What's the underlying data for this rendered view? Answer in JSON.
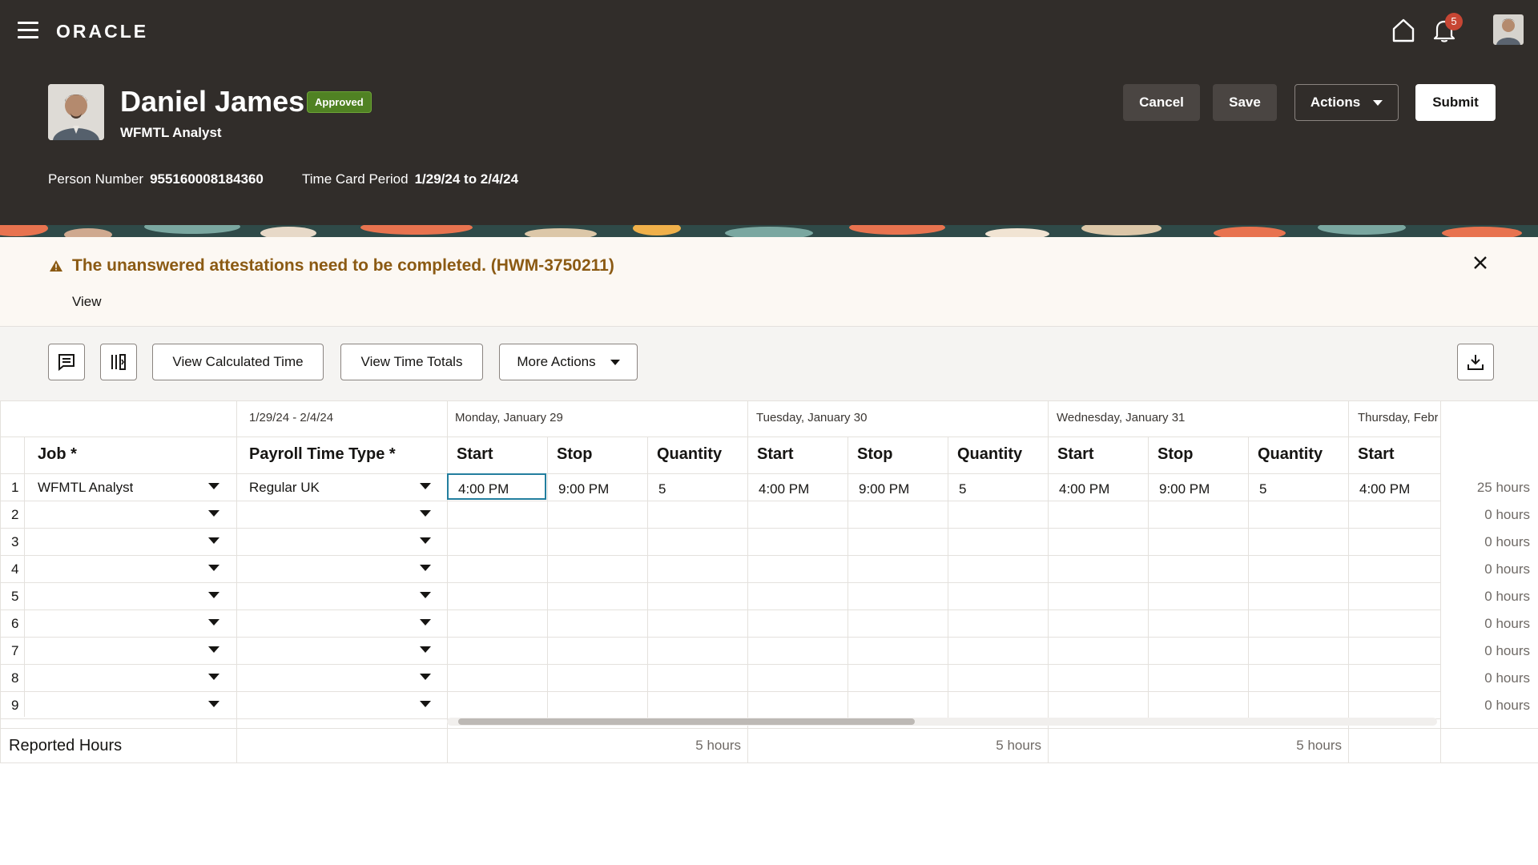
{
  "header": {
    "brand": "ORACLE",
    "notification_count": "5",
    "person_name": "Daniel James",
    "status": "Approved",
    "job_title": "WFMTL Analyst",
    "buttons": {
      "cancel": "Cancel",
      "save": "Save",
      "actions": "Actions",
      "submit": "Submit"
    },
    "person_number_label": "Person Number",
    "person_number": "955160008184360",
    "period_label": "Time Card Period",
    "period": "1/29/24 to 2/4/24"
  },
  "warning": {
    "message": "The unanswered attestations need to be completed. (HWM-3750211)",
    "link": "View"
  },
  "toolbar": {
    "view_calculated": "View Calculated Time",
    "view_totals": "View Time Totals",
    "more_actions": "More Actions"
  },
  "grid": {
    "range": "1/29/24 - 2/4/24",
    "days": [
      "Monday, January 29",
      "Tuesday, January 30",
      "Wednesday, January 31",
      "Thursday, Febr"
    ],
    "columns": {
      "job": "Job *",
      "payroll": "Payroll Time Type *",
      "start": "Start",
      "stop": "Stop",
      "quantity": "Quantity"
    },
    "rows": [
      {
        "num": "1",
        "job": "WFMTL Analyst",
        "payroll": "Regular UK",
        "mon_start": "4:00 PM",
        "mon_stop": "9:00 PM",
        "mon_qty": "5",
        "tue_start": "4:00 PM",
        "tue_stop": "9:00 PM",
        "tue_qty": "5",
        "wed_start": "4:00 PM",
        "wed_stop": "9:00 PM",
        "wed_qty": "5",
        "thu_start": "4:00 PM",
        "total": "25 hours"
      },
      {
        "num": "2",
        "total": "0 hours"
      },
      {
        "num": "3",
        "total": "0 hours"
      },
      {
        "num": "4",
        "total": "0 hours"
      },
      {
        "num": "5",
        "total": "0 hours"
      },
      {
        "num": "6",
        "total": "0 hours"
      },
      {
        "num": "7",
        "total": "0 hours"
      },
      {
        "num": "8",
        "total": "0 hours"
      },
      {
        "num": "9",
        "total": "0 hours"
      }
    ],
    "reported_label": "Reported Hours",
    "reported": [
      "5 hours",
      "5 hours",
      "5 hours"
    ]
  }
}
